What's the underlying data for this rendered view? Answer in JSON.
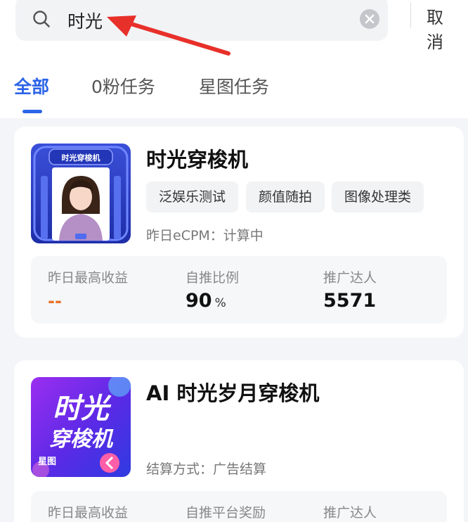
{
  "search": {
    "query": "时光",
    "cancel_label": "取消"
  },
  "tabs": [
    {
      "label": "全部",
      "active": true
    },
    {
      "label": "0粉任务",
      "active": false
    },
    {
      "label": "星图任务",
      "active": false
    }
  ],
  "tasks": [
    {
      "title": "时光穿梭机",
      "thumb_banner": "时光穿梭机",
      "tags": [
        "泛娱乐测试",
        "颜值随拍",
        "图像处理类"
      ],
      "sub_line": "昨日eCPM：计算中",
      "stats": [
        {
          "label": "昨日最高收益",
          "value": "--"
        },
        {
          "label": "自推比例",
          "value": "90",
          "unit": "%"
        },
        {
          "label": "推广达人",
          "value": "5571"
        }
      ]
    },
    {
      "title": "AI 时光岁月穿梭机",
      "thumb_line1": "时光",
      "thumb_line2": "穿梭机",
      "thumb_badge": "星图",
      "sub_line": "结算方式：广告结算",
      "stats": [
        {
          "label": "昨日最高收益"
        },
        {
          "label": "自推平台奖励"
        },
        {
          "label": "推广达人"
        }
      ]
    }
  ],
  "colors": {
    "accent": "#2b64e8",
    "annotation_arrow": "#e8302a",
    "dash": "#e8722a"
  }
}
